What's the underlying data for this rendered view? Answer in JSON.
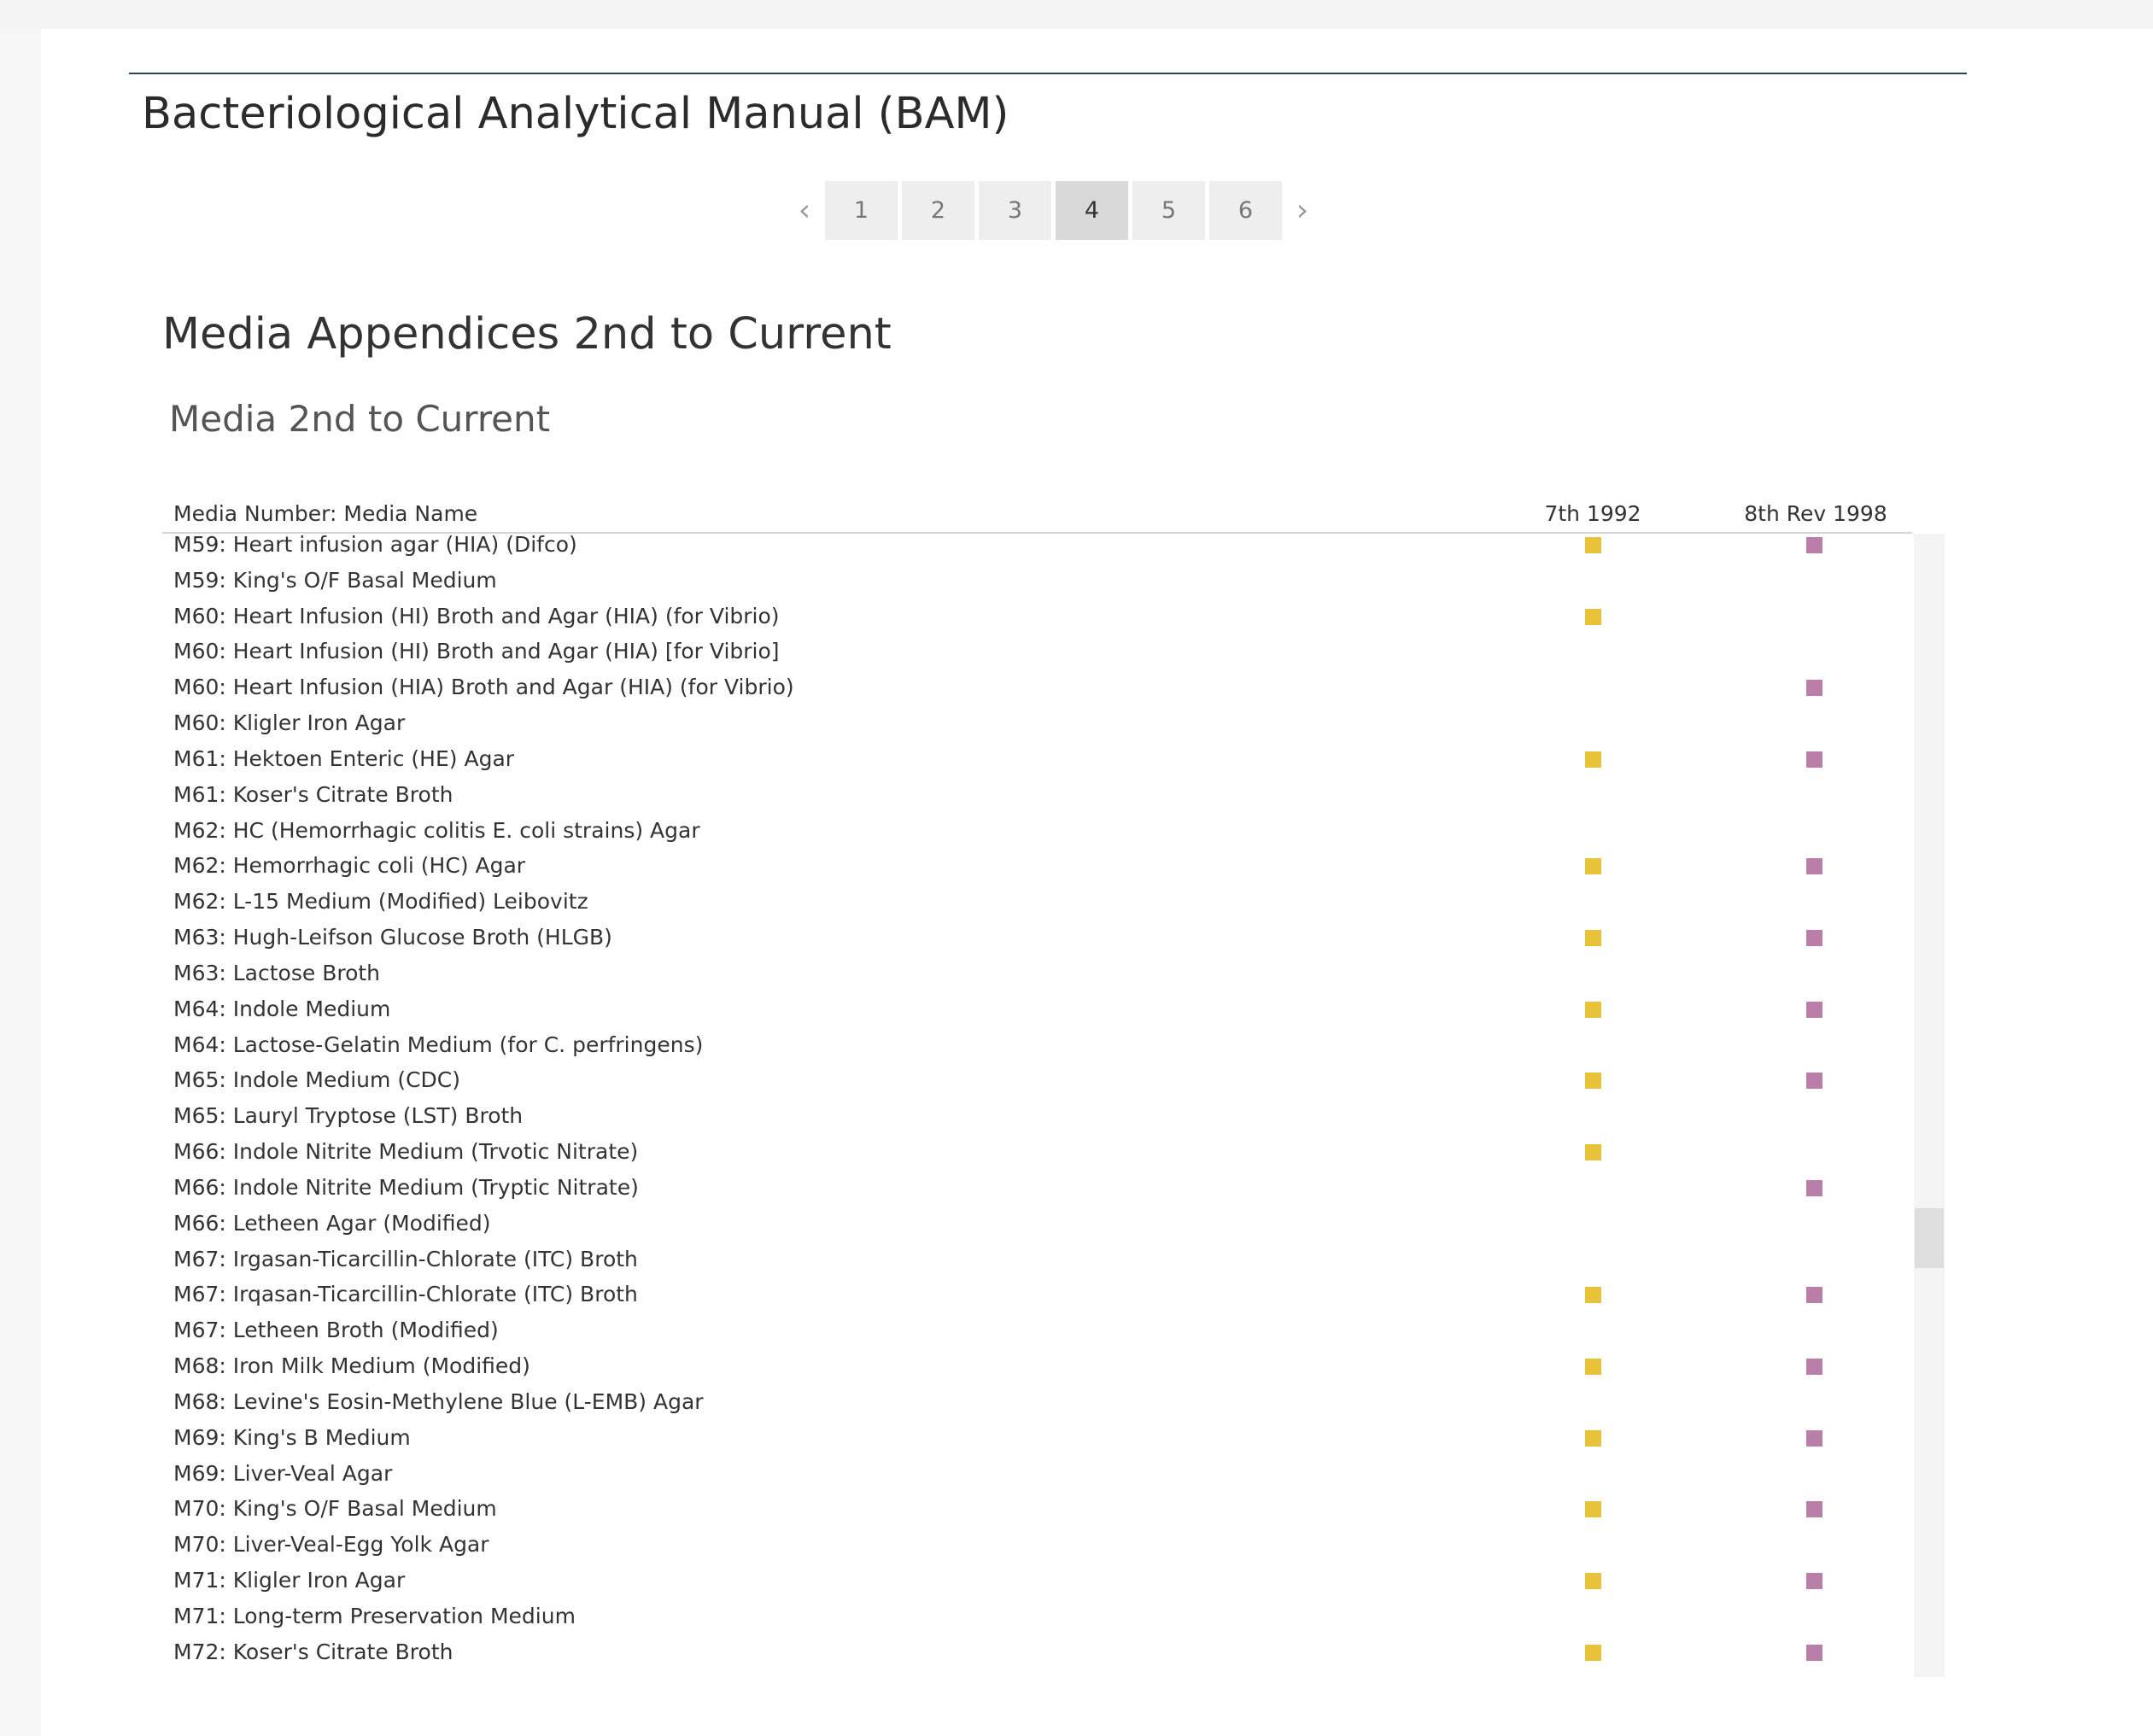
{
  "app": {
    "title": "Bacteriological Analytical Manual (BAM)"
  },
  "pagination": {
    "prev_icon": "chevron-left-icon",
    "next_icon": "chevron-right-icon",
    "prev_glyph": "‹",
    "next_glyph": "›",
    "pages": [
      "1",
      "2",
      "3",
      "4",
      "5",
      "6"
    ],
    "current": "4"
  },
  "section": {
    "title": "Media Appendices 2nd to Current",
    "subtitle": "Media 2nd to Current"
  },
  "table": {
    "columns": [
      "Media Number: Media Name",
      "7th 1992",
      "8th Rev 1998"
    ],
    "marker_colors": {
      "7th 1992": "#e8c33a",
      "8th Rev 1998": "#b97fa8"
    },
    "rows": [
      {
        "name": "M59: Heart infusion agar (HIA) (Difco)",
        "ed7": true,
        "ed8": true
      },
      {
        "name": "M59: King's O/F Basal Medium",
        "ed7": false,
        "ed8": false
      },
      {
        "name": "M60: Heart Infusion (HI) Broth and Agar (HIA) (for Vibrio)",
        "ed7": true,
        "ed8": false
      },
      {
        "name": "M60: Heart Infusion (HI) Broth and Agar (HIA) [for Vibrio]",
        "ed7": false,
        "ed8": false
      },
      {
        "name": "M60: Heart Infusion (HIA) Broth and Agar (HIA) (for Vibrio)",
        "ed7": false,
        "ed8": true
      },
      {
        "name": "M60: Kligler Iron Agar",
        "ed7": false,
        "ed8": false
      },
      {
        "name": "M61: Hektoen Enteric (HE) Agar",
        "ed7": true,
        "ed8": true
      },
      {
        "name": "M61: Koser's Citrate Broth",
        "ed7": false,
        "ed8": false
      },
      {
        "name": "M62: HC (Hemorrhagic colitis E. coli strains) Agar",
        "ed7": false,
        "ed8": false
      },
      {
        "name": "M62: Hemorrhagic coli (HC) Agar",
        "ed7": true,
        "ed8": true
      },
      {
        "name": "M62: L-15 Medium (Modified) Leibovitz",
        "ed7": false,
        "ed8": false
      },
      {
        "name": "M63: Hugh-Leifson Glucose Broth (HLGB)",
        "ed7": true,
        "ed8": true
      },
      {
        "name": "M63: Lactose Broth",
        "ed7": false,
        "ed8": false
      },
      {
        "name": "M64: Indole Medium",
        "ed7": true,
        "ed8": true
      },
      {
        "name": "M64: Lactose-Gelatin Medium (for C. perfringens)",
        "ed7": false,
        "ed8": false
      },
      {
        "name": "M65: Indole Medium (CDC)",
        "ed7": true,
        "ed8": true
      },
      {
        "name": "M65: Lauryl Tryptose (LST) Broth",
        "ed7": false,
        "ed8": false
      },
      {
        "name": "M66: Indole Nitrite Medium (Trvotic Nitrate)",
        "ed7": true,
        "ed8": false
      },
      {
        "name": "M66: Indole Nitrite Medium (Tryptic Nitrate)",
        "ed7": false,
        "ed8": true
      },
      {
        "name": "M66: Letheen Agar (Modified)",
        "ed7": false,
        "ed8": false
      },
      {
        "name": "M67: Irgasan-Ticarcillin-Chlorate (ITC) Broth",
        "ed7": false,
        "ed8": false
      },
      {
        "name": "M67: Irqasan-Ticarcillin-Chlorate (ITC) Broth",
        "ed7": true,
        "ed8": true
      },
      {
        "name": "M67: Letheen Broth (Modified)",
        "ed7": false,
        "ed8": false
      },
      {
        "name": "M68: Iron Milk Medium (Modified)",
        "ed7": true,
        "ed8": true
      },
      {
        "name": "M68: Levine's Eosin-Methylene Blue (L-EMB) Agar",
        "ed7": false,
        "ed8": false
      },
      {
        "name": "M69: King's B Medium",
        "ed7": true,
        "ed8": true
      },
      {
        "name": "M69: Liver-Veal Agar",
        "ed7": false,
        "ed8": false
      },
      {
        "name": "M70: King's O/F Basal Medium",
        "ed7": true,
        "ed8": true
      },
      {
        "name": "M70: Liver-Veal-Egg Yolk Agar",
        "ed7": false,
        "ed8": false
      },
      {
        "name": "M71: Kligler Iron Agar",
        "ed7": true,
        "ed8": true
      },
      {
        "name": "M71: Long-term Preservation Medium",
        "ed7": false,
        "ed8": false
      },
      {
        "name": "M72: Koser's Citrate Broth",
        "ed7": true,
        "ed8": true
      }
    ]
  }
}
